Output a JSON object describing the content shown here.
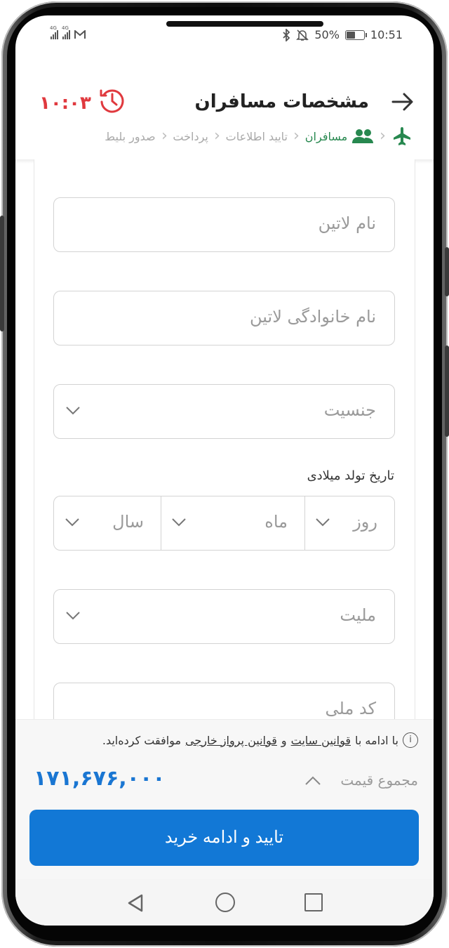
{
  "status_bar": {
    "signal1_tag": "4G",
    "signal2_tag": "4G",
    "battery_percent": "50%",
    "battery_level": 0.5,
    "time": "10:51"
  },
  "header": {
    "title": "مشخصات مسافران",
    "timer": "۱۰:۰۳"
  },
  "steps": [
    {
      "label": "مسافران",
      "active": true
    },
    {
      "label": "تایید اطلاعات",
      "active": false
    },
    {
      "label": "پرداخت",
      "active": false
    },
    {
      "label": "صدور بلیط",
      "active": false
    }
  ],
  "form": {
    "latin_name_placeholder": "نام لاتین",
    "latin_lastname_placeholder": "نام خانوادگی لاتین",
    "gender_placeholder": "جنسیت",
    "dob_label": "تاریخ تولد میلادی",
    "dob_day": "روز",
    "dob_month": "ماه",
    "dob_year": "سال",
    "nationality_placeholder": "ملیت",
    "national_code_placeholder": "کد ملی"
  },
  "footer": {
    "terms_prefix": "با ادامه با",
    "terms_site": "قوانین سایت",
    "terms_and": "و",
    "terms_flight": "قوانین پرواز خارجی",
    "terms_suffix": "موافقت کرده‌اید.",
    "price_label": "مجموع قیمت",
    "price_value": "۱۷۱,۶۷۶,۰۰۰",
    "confirm_label": "تایید و ادامه خرید"
  },
  "colors": {
    "accent": "#1278d6",
    "timer": "#e0393e",
    "active_step": "#27884f"
  }
}
